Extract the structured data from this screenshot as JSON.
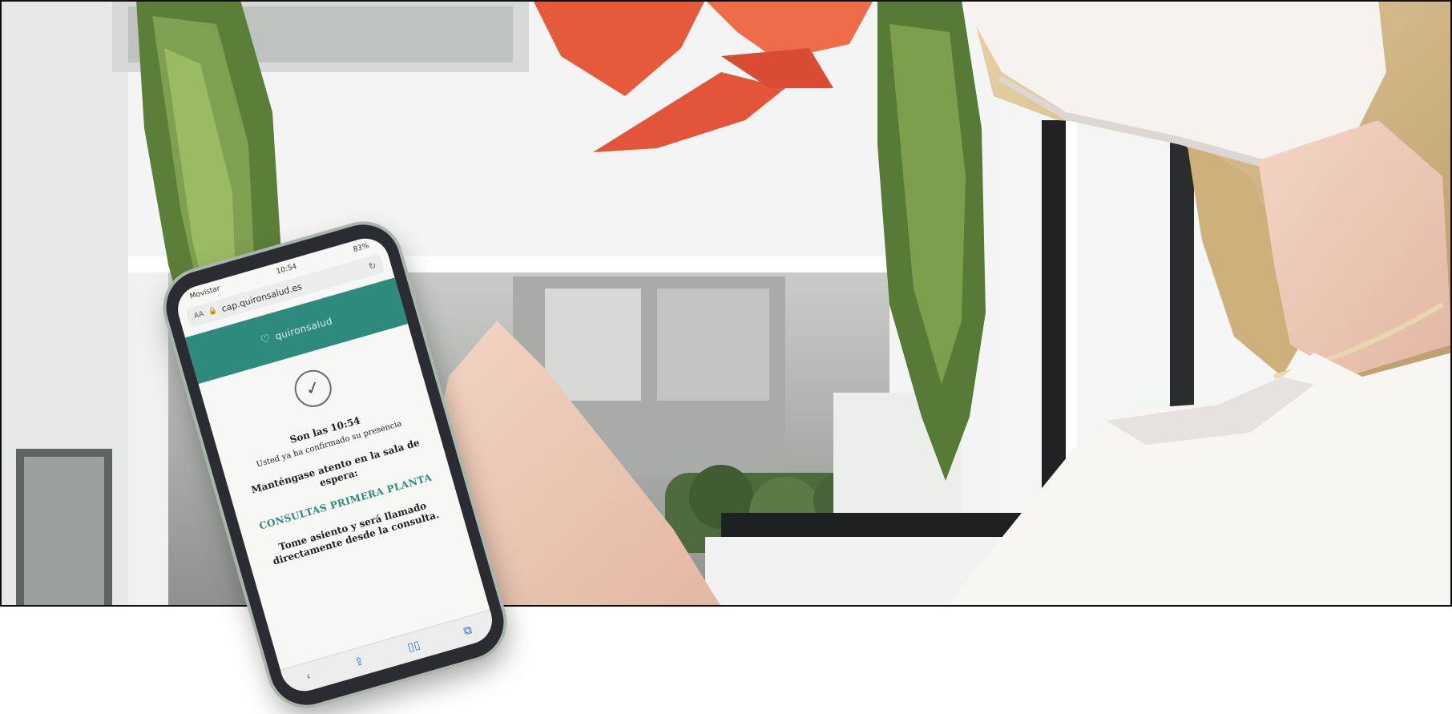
{
  "phone": {
    "status_left": "Movistar",
    "status_time": "10:54",
    "status_right": "83%",
    "aa_label": "AA",
    "lock_icon": "lock-icon",
    "url": "cap.quironsalud.es",
    "reload_icon": "reload-icon",
    "brand": "quironsalud",
    "check_icon": "check-circle-icon",
    "message": {
      "time_line": "Son las 10:54",
      "confirm_line": "Usted ya ha confirmado su presencia",
      "wait_line": "Manténgase atento en la sala de espera:",
      "room_line": "CONSULTAS PRIMERA PLANTA",
      "call_line": "Tome asiento y será llamado directamente desde la consulta."
    },
    "toolbar_icons": [
      "back-icon",
      "share-icon",
      "book-icon",
      "tabs-icon"
    ],
    "colors": {
      "brand_teal": "#2e8a7c",
      "screen_bg": "#f7f7f6",
      "phone_frame": "#2a2c31"
    }
  }
}
